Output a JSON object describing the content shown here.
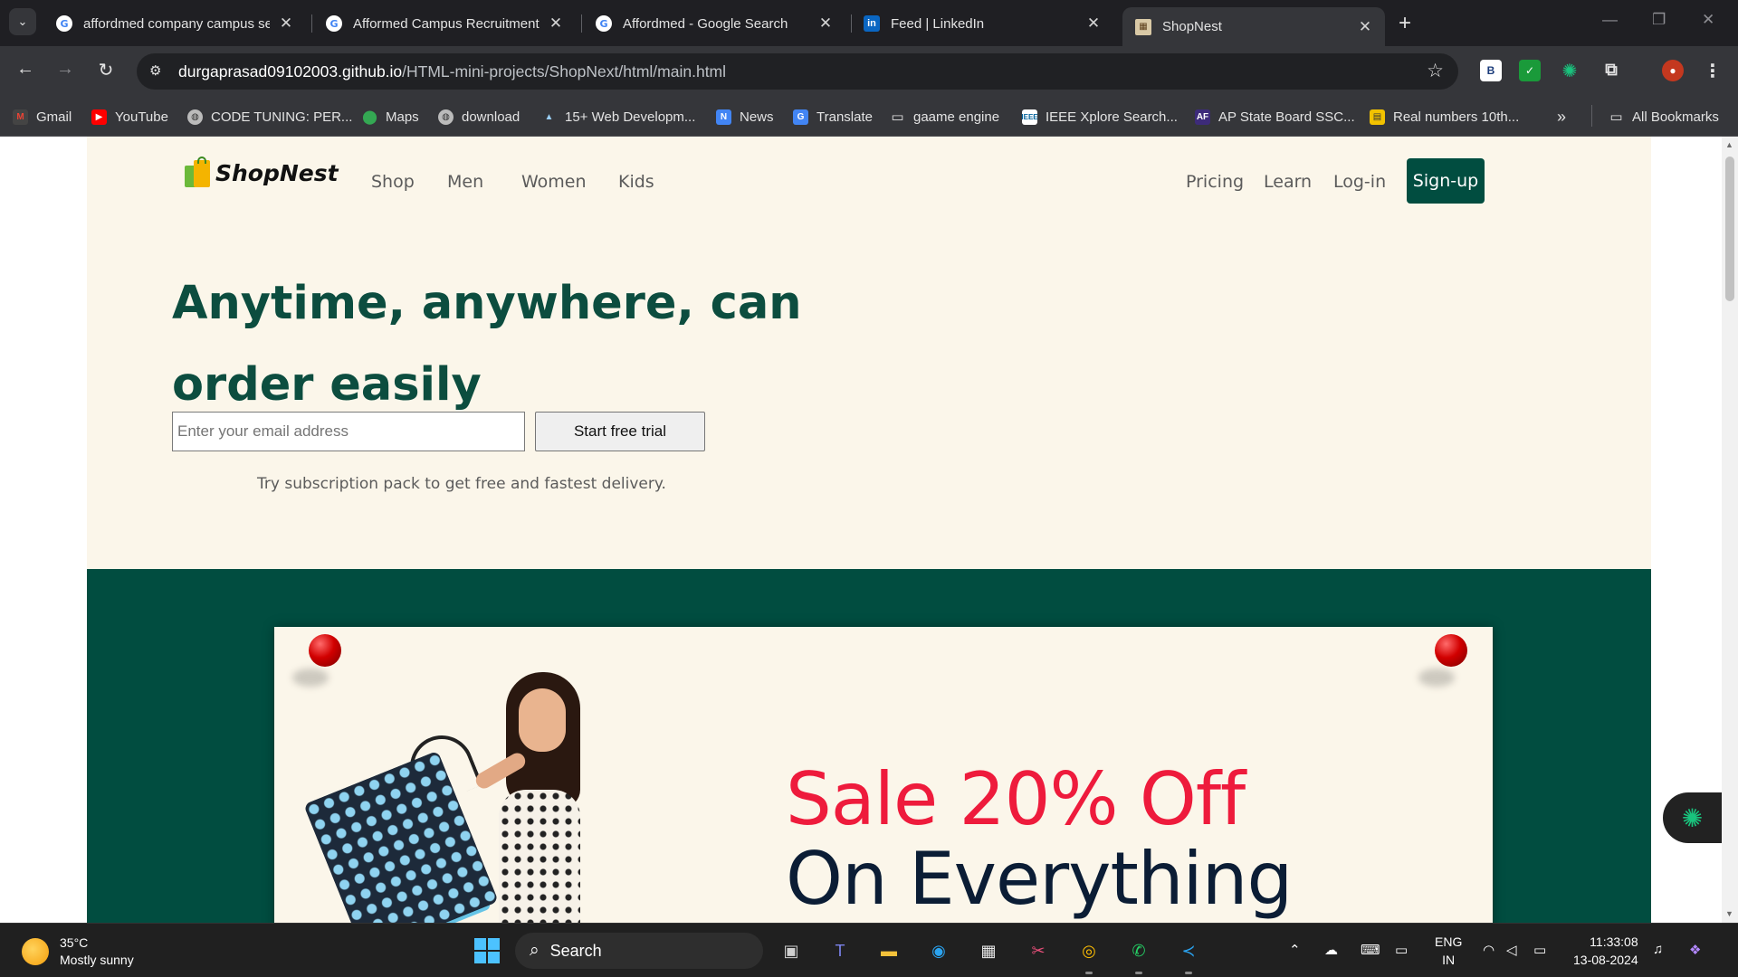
{
  "browser": {
    "tabs": [
      {
        "title": "affordmed company campus se",
        "favicon": "google-icon",
        "active": false
      },
      {
        "title": "Afformed Campus Recruitment",
        "favicon": "google-icon",
        "active": false
      },
      {
        "title": "Affordmed - Google Search",
        "favicon": "google-icon",
        "active": false
      },
      {
        "title": "Feed | LinkedIn",
        "favicon": "linkedin-icon",
        "active": false
      },
      {
        "title": "ShopNest",
        "favicon": "shopnest-icon",
        "active": true
      }
    ],
    "address": {
      "host": "durgaprasad09102003.github.io",
      "path": "/HTML-mini-projects/ShopNext/html/main.html"
    },
    "extensions": [
      "b-extension-icon",
      "check-extension-icon",
      "chatgpt-extension-icon",
      "puzzle-icon",
      "profile-avatar"
    ],
    "bookmarks": [
      {
        "label": "Gmail",
        "icon": "gmail-icon"
      },
      {
        "label": "YouTube",
        "icon": "youtube-icon"
      },
      {
        "label": "CODE TUNING: PER...",
        "icon": "globe-icon"
      },
      {
        "label": "Maps",
        "icon": "maps-icon"
      },
      {
        "label": "download",
        "icon": "globe-icon"
      },
      {
        "label": "15+ Web Developm...",
        "icon": "mountain-icon"
      },
      {
        "label": "News",
        "icon": "news-icon"
      },
      {
        "label": "Translate",
        "icon": "translate-icon"
      },
      {
        "label": "gaame engine",
        "icon": "folder-icon"
      },
      {
        "label": "IEEE Xplore Search...",
        "icon": "ieee-icon"
      },
      {
        "label": "AP State Board SSC...",
        "icon": "af-icon"
      },
      {
        "label": "Real numbers 10th...",
        "icon": "book-icon"
      }
    ],
    "all_bookmarks": "All Bookmarks"
  },
  "site": {
    "brand": "ShopNest",
    "nav_left": [
      "Shop",
      "Men",
      "Women",
      "Kids"
    ],
    "nav_right": [
      "Pricing",
      "Learn",
      "Log-in"
    ],
    "signup": "Sign-up",
    "hero": {
      "title": "Anytime, anywhere, can order easily",
      "email_placeholder": "Enter your email address",
      "cta": "Start free trial",
      "subtitle": "Try subscription pack to get free and fastest delivery."
    },
    "sale": {
      "line1": "Sale 20% Off",
      "line2": "On Everything"
    },
    "colors": {
      "brand_green": "#014d40",
      "hero_title": "#0c4d3f",
      "page_bg": "#fbf6ea",
      "sale_red": "#ee1b3c",
      "sale_navy": "#0b1d35"
    }
  },
  "taskbar": {
    "weather_temp": "35°C",
    "weather_desc": "Mostly sunny",
    "search_label": "Search",
    "lang_1": "ENG",
    "lang_2": "IN",
    "time": "11:33:08",
    "date": "13-08-2024"
  }
}
